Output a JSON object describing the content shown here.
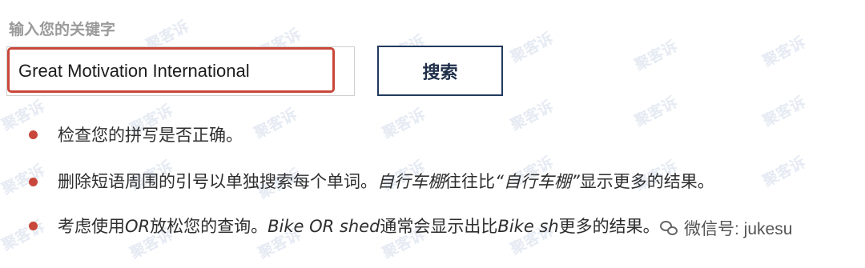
{
  "search": {
    "label": "输入您的关键字",
    "value": "Great Motivation International",
    "button_label": "搜索"
  },
  "tips": {
    "tip1": {
      "text": "检查您的拼写是否正确。"
    },
    "tip2": {
      "part1": "删除短语周围的引号以单独搜索每个单词。",
      "part2_italic": "自行车棚",
      "part3": "往往比",
      "part4_italic": "“自行车棚”",
      "part5": "显示更多的结果。"
    },
    "tip3": {
      "part1": "考虑使用",
      "part2_italic": "OR",
      "part3": "放松您的查询。",
      "part4_italic": "Bike OR shed",
      "part5": "通常会显示出比",
      "part6_italic": "Bike sh",
      "part7": "更多的结果。"
    }
  },
  "watermark": {
    "text": "聚客诉"
  },
  "brand": {
    "text": "微信号: jukesu",
    "icon": "wechat-icon"
  },
  "colors": {
    "accent_red": "#c9473a",
    "button_border": "#223a5e",
    "label_gray": "#9a9a9a",
    "watermark": "#e6ebf3"
  }
}
